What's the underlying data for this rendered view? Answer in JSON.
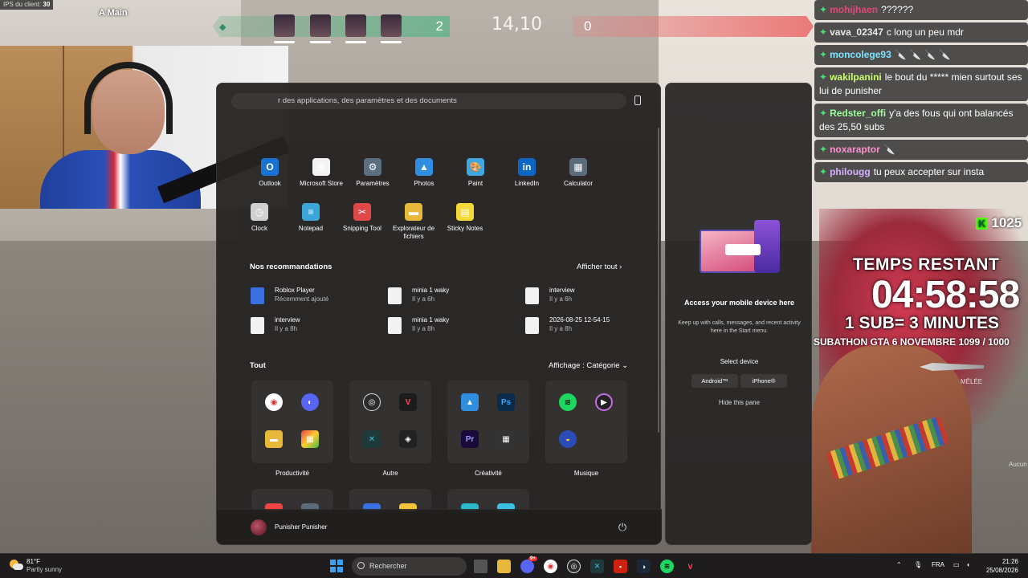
{
  "overlay": {
    "ips_label": "IPS du client:",
    "ips_value": "30",
    "team_label": "A Main"
  },
  "hud": {
    "left_score": "2",
    "timer": "14,10",
    "right_score": "0"
  },
  "chat": {
    "messages": [
      {
        "user": "mohijhaen",
        "text": "??????",
        "user_color": "#e0487a"
      },
      {
        "user": "vava_02347",
        "text": "c long un peu mdr",
        "user_color": "#e8e8e8"
      },
      {
        "user": "moncolege93",
        "text": "🔪 🔪 🔪 🔪",
        "user_color": "#7de3ff"
      },
      {
        "user": "wakilpanini",
        "text": "le bout du ***** mien surtout ses lui de punisher",
        "user_color": "#c9ff70"
      },
      {
        "user": "Redster_offi",
        "text": "y'a des fous qui ont balancés des 25,50 subs",
        "user_color": "#9bff9b"
      },
      {
        "user": "noxaraptor",
        "text": "🔪",
        "user_color": "#ff8fd0"
      },
      {
        "user": "philougg",
        "text": "tu peux accepter sur insta",
        "user_color": "#d8b0ff"
      }
    ],
    "k_count": "1025"
  },
  "subathon": {
    "title": "TEMPS RESTANT",
    "timer": "04:58:58",
    "rate": "1 SUB= 3 MINUTES",
    "goal": "SUBATHON GTA 6 NOVEMBRE 1099 / 1000"
  },
  "game_hud": {
    "melee": "MÊLÉE",
    "aucun": "Aucun"
  },
  "start_menu": {
    "search_placeholder": "r des applications, des paramètres et des documents",
    "pinned": [
      {
        "name": "Outlook",
        "icon": "outlook-icon",
        "color": "#1873d3",
        "glyph": "O"
      },
      {
        "name": "Microsoft Store",
        "icon": "store-icon",
        "color": "#f3f3f3",
        "glyph": "⊞"
      },
      {
        "name": "Paramètres",
        "icon": "settings-icon",
        "color": "#5c6f80",
        "glyph": "⚙"
      },
      {
        "name": "Photos",
        "icon": "photos-icon",
        "color": "#2f8ee0",
        "glyph": "▲"
      },
      {
        "name": "Paint",
        "icon": "paint-icon",
        "color": "#3fa7e0",
        "glyph": "🎨"
      },
      {
        "name": "LinkedIn",
        "icon": "linkedin-icon",
        "color": "#0a66c2",
        "glyph": "in"
      },
      {
        "name": "Calculator",
        "icon": "calculator-icon",
        "color": "#5a6b7a",
        "glyph": "▦"
      },
      {
        "name": "Clock",
        "icon": "clock-icon",
        "color": "#d0d0d0",
        "glyph": "◷"
      },
      {
        "name": "Notepad",
        "icon": "notepad-icon",
        "color": "#3ba7d8",
        "glyph": "≡"
      },
      {
        "name": "Snipping Tool",
        "icon": "snipping-tool-icon",
        "color": "#e04848",
        "glyph": "✂"
      },
      {
        "name": "Explorateur de fichiers",
        "icon": "file-explorer-icon",
        "color": "#e8b83a",
        "glyph": "▬"
      },
      {
        "name": "Sticky Notes",
        "icon": "sticky-notes-icon",
        "color": "#f3d836",
        "glyph": "▤"
      }
    ],
    "recommendations_title": "Nos recommandations",
    "show_all_label": "Afficher tout  ›",
    "recommendations": [
      {
        "name": "Roblox Player",
        "time": "Récemment ajouté"
      },
      {
        "name": "minia 1 waky",
        "time": "Il y a 6h"
      },
      {
        "name": "interview",
        "time": "Il y a 6h"
      },
      {
        "name": "interview",
        "time": "Il y a 8h"
      },
      {
        "name": "minia 1 waky",
        "time": "Il y a 8h"
      },
      {
        "name": "2026-08-25 12-54-15",
        "time": "Il y a 8h"
      }
    ],
    "all_title": "Tout",
    "view_label": "Affichage : Catégorie  ⌄",
    "categories": [
      {
        "label": "Productivité"
      },
      {
        "label": "Autre"
      },
      {
        "label": "Créativité"
      },
      {
        "label": "Musique"
      }
    ],
    "user_name": "Punisher Punisher"
  },
  "phone_pane": {
    "title": "Access your mobile device here",
    "description": "Keep up with calls, messages, and recent activity here in the Start menu.",
    "select_label": "Select device",
    "android_label": "Android™",
    "iphone_label": "iPhone®",
    "hide_label": "Hide this pane"
  },
  "taskbar": {
    "temperature": "81°F",
    "condition": "Partly sunny",
    "search_label": "Rechercher",
    "language": "FRA",
    "time": "21:26",
    "date": "25/08/2026",
    "discord_badge": "9+"
  }
}
